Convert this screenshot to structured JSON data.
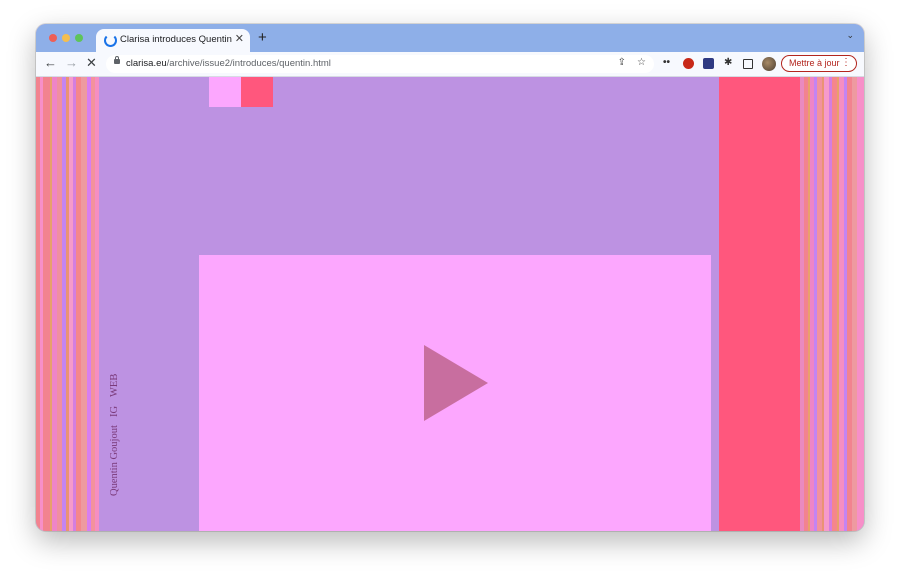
{
  "browser": {
    "tab": {
      "title": "Clarisa introduces Quentin"
    },
    "newtab_glyph": "+",
    "tablist_glyph": "⌄",
    "nav": {
      "back_glyph": "←",
      "forward_glyph": "→",
      "stop_glyph": "✕"
    },
    "address": {
      "host": "clarisa.eu",
      "path": "/archive/issue2/introduces/quentin.html"
    },
    "extensions": [
      "share-icon",
      "star-icon",
      "extension-dots-icon",
      "ublock-icon",
      "bolt-extension-icon",
      "puzzle-icon",
      "sidepanel-icon"
    ],
    "update_button": {
      "label": "Mettre à jour",
      "menu_glyph": "⋮"
    },
    "accent_color": "#8eafe8"
  },
  "page": {
    "nav_links": {
      "web": "WEB",
      "ig": "IG",
      "name": "Quentin Goujout"
    },
    "colors": {
      "background": "#bd92e2",
      "video": "#fca7fe",
      "accent_red": "#ff577d",
      "play": "#c86e9f"
    },
    "video": {
      "control": "play-icon"
    }
  }
}
